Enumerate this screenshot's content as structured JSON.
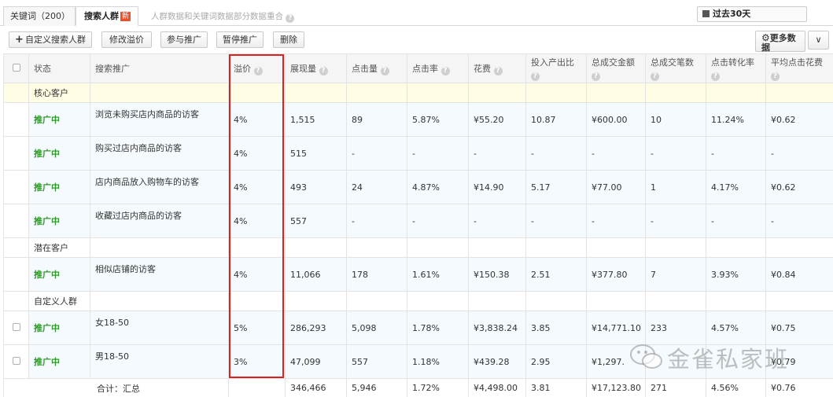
{
  "tabs": {
    "keywords_label": "关键词（200）",
    "crowd_label": "搜索人群",
    "new_badge": "新",
    "note": "人群数据和关键词数据部分数据重合",
    "date_range": "过去30天"
  },
  "toolbar": {
    "add_label": "自定义搜索人群",
    "add_plus": "+",
    "edit_premium_label": "修改溢价",
    "join_label": "参与推广",
    "pause_label": "暂停推广",
    "delete_label": "删除",
    "more_label_line1": "更多数",
    "more_label_line2": "据",
    "dropdown_glyph": "∨"
  },
  "columns": {
    "status": "状态",
    "name": "搜索推广",
    "premium": "溢价",
    "impressions": "展现量",
    "clicks": "点击量",
    "ctr": "点击率",
    "cost": "花费",
    "roi": "投入产出比",
    "gmv": "总成交金额",
    "orders": "总成交笔数",
    "cvr": "点击转化率",
    "cpc": "平均点击花费"
  },
  "groups": [
    {
      "label": "核心客户",
      "rows": [
        {
          "status": "推广中",
          "name": "浏览未购买店内商品的访客",
          "premium": "4%",
          "impressions": "1,515",
          "clicks": "89",
          "ctr": "5.87%",
          "cost": "¥55.20",
          "roi": "10.87",
          "gmv": "¥600.00",
          "orders": "10",
          "cvr": "11.24%",
          "cpc": "¥0.62"
        },
        {
          "status": "推广中",
          "name": "购买过店内商品的访客",
          "premium": "4%",
          "impressions": "515",
          "clicks": "-",
          "ctr": "-",
          "cost": "-",
          "roi": "-",
          "gmv": "-",
          "orders": "-",
          "cvr": "-",
          "cpc": "-"
        },
        {
          "status": "推广中",
          "name": "店内商品放入购物车的访客",
          "premium": "4%",
          "impressions": "493",
          "clicks": "24",
          "ctr": "4.87%",
          "cost": "¥14.90",
          "roi": "5.17",
          "gmv": "¥77.00",
          "orders": "1",
          "cvr": "4.17%",
          "cpc": "¥0.62"
        },
        {
          "status": "推广中",
          "name": "收藏过店内商品的访客",
          "premium": "4%",
          "impressions": "557",
          "clicks": "-",
          "ctr": "-",
          "cost": "-",
          "roi": "-",
          "gmv": "-",
          "orders": "-",
          "cvr": "-",
          "cpc": "-"
        }
      ]
    },
    {
      "label": "潜在客户",
      "rows": [
        {
          "status": "推广中",
          "name": "相似店铺的访客",
          "premium": "4%",
          "impressions": "11,066",
          "clicks": "178",
          "ctr": "1.61%",
          "cost": "¥150.38",
          "roi": "2.51",
          "gmv": "¥377.80",
          "orders": "7",
          "cvr": "3.93%",
          "cpc": "¥0.84"
        }
      ]
    },
    {
      "label": "自定义人群",
      "rows": [
        {
          "status": "推广中",
          "name": "女18-50",
          "premium": "5%",
          "impressions": "286,293",
          "clicks": "5,098",
          "ctr": "1.78%",
          "cost": "¥3,838.24",
          "roi": "3.85",
          "gmv": "¥14,771.10",
          "orders": "233",
          "cvr": "4.57%",
          "cpc": "¥0.75"
        },
        {
          "status": "推广中",
          "name": "男18-50",
          "premium": "3%",
          "impressions": "47,099",
          "clicks": "557",
          "ctr": "1.18%",
          "cost": "¥439.28",
          "roi": "2.95",
          "gmv": "¥1,297.",
          "orders": "",
          "cvr": "",
          "cpc": "¥0.79"
        }
      ]
    }
  ],
  "total": {
    "label": "合计：汇总",
    "impressions": "346,466",
    "clicks": "5,946",
    "ctr": "1.72%",
    "cost": "¥4,498.00",
    "roi": "3.81",
    "gmv": "¥17,123.80",
    "orders": "271",
    "cvr": "4.56%",
    "cpc": "¥0.76"
  },
  "watermark": "金雀私家班"
}
